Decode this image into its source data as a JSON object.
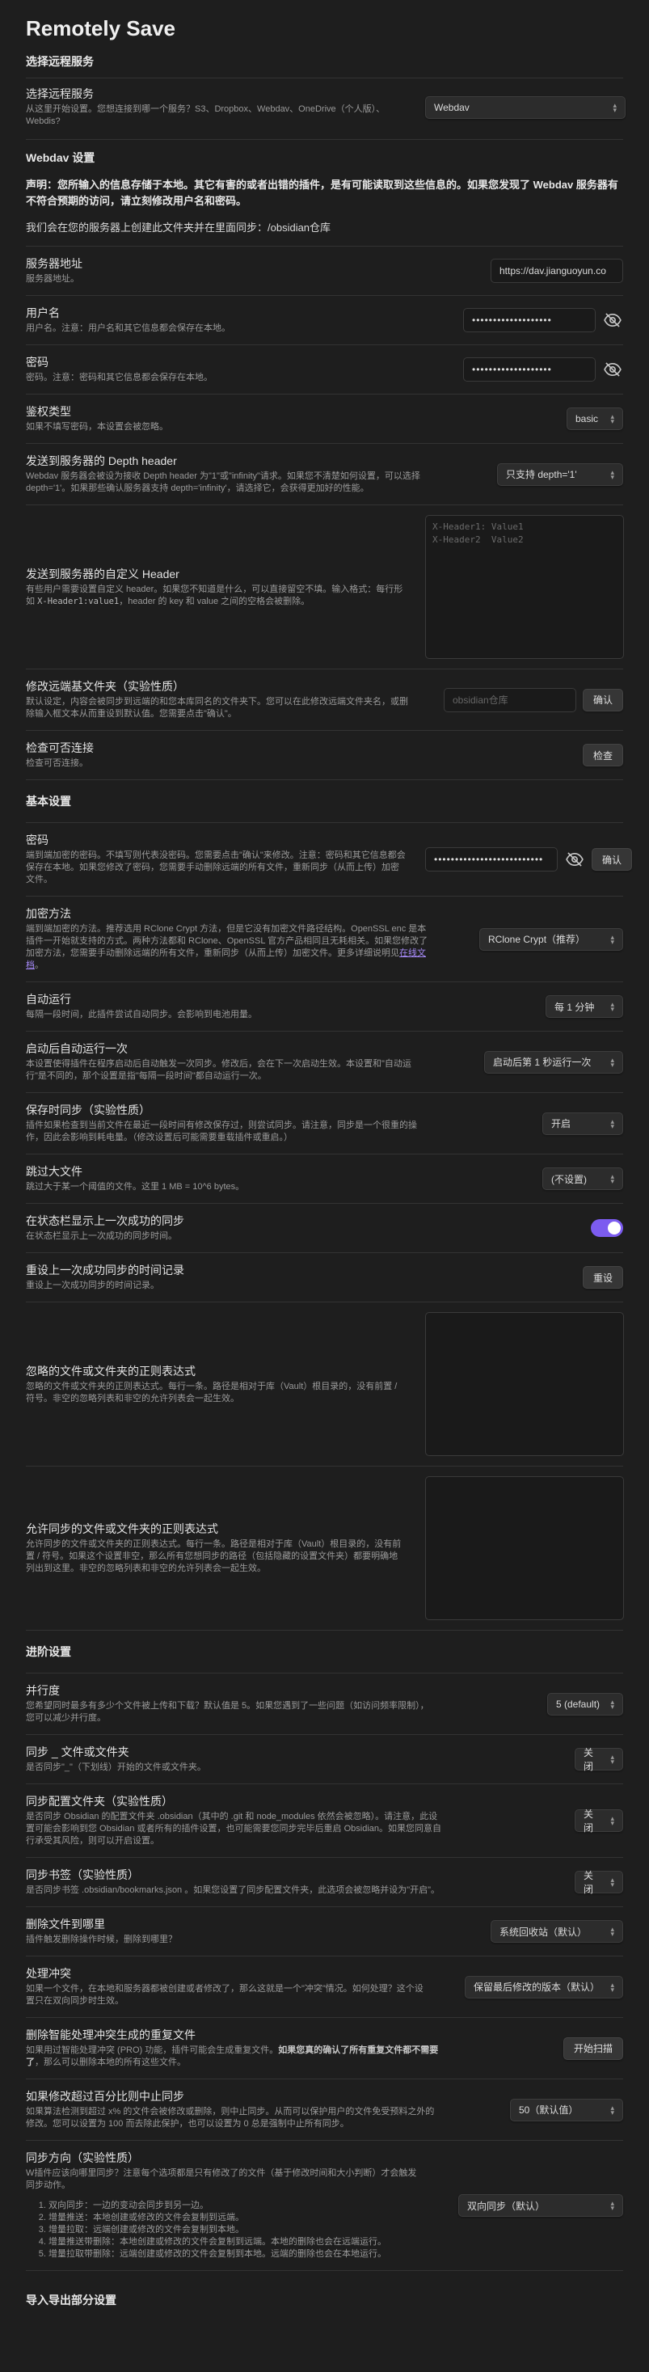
{
  "title": "Remotely Save",
  "choose_service": {
    "heading": "选择远程服务",
    "name": "选择远程服务",
    "desc": "从这里开始设置。您想连接到哪一个服务？S3、Dropbox、Webdav、OneDrive（个人版）、Webdis?",
    "value": "Webdav"
  },
  "webdav": {
    "heading": "Webdav 设置",
    "warning": "声明：您所输入的信息存储于本地。其它有害的或者出错的插件，是有可能读取到这些信息的。如果您发现了 Webdav 服务器有不符合预期的访问，请立刻修改用户名和密码。",
    "folder_note": "我们会在您的服务器上创建此文件夹并在里面同步：/obsidian仓库",
    "server": {
      "name": "服务器地址",
      "desc": "服务器地址。",
      "value": "https://dav.jianguoyun.co"
    },
    "username": {
      "name": "用户名",
      "desc": "用户名。注意：用户名和其它信息都会保存在本地。",
      "value": "•••••••••••••••••••"
    },
    "password": {
      "name": "密码",
      "desc": "密码。注意：密码和其它信息都会保存在本地。",
      "value": "•••••••••••••••••••"
    },
    "auth": {
      "name": "鉴权类型",
      "desc": "如果不填写密码，本设置会被忽略。",
      "value": "basic"
    },
    "depth": {
      "name": "发送到服务器的 Depth header",
      "desc": "Webdav 服务器会被设为接收 Depth header 为\"1\"或\"infinity\"请求。如果您不清楚如何设置，可以选择 depth='1'。如果那些确认服务器支持 depth='infinity'，请选择它，会获得更加好的性能。",
      "value": "只支持 depth='1'"
    },
    "custom_header": {
      "name": "发送到服务器的自定义 Header",
      "desc_prefix": "有些用户需要设置自定义 header。如果您不知道是什么，可以直接留空不填。输入格式：每行形如 ",
      "desc_code": "X-Header1:value1",
      "desc_suffix": "，header 的 key 和 value 之间的空格会被删除。",
      "placeholder": "X-Header1: Value1\nX-Header2  Value2"
    },
    "remote_folder": {
      "name": "修改远端基文件夹（实验性质）",
      "desc": "默认设定，内容会被同步到远端的和您本库同名的文件夹下。您可以在此修改远端文件夹名，或删除输入框文本从而重设到默认值。您需要点击\"确认\"。",
      "placeholder": "obsidian仓库",
      "button": "确认"
    },
    "check": {
      "name": "检查可否连接",
      "desc": "检查可否连接。",
      "button": "检查"
    }
  },
  "basic": {
    "heading": "基本设置",
    "password": {
      "name": "密码",
      "desc": "端到端加密的密码。不填写则代表没密码。您需要点击\"确认\"来修改。注意：密码和其它信息都会保存在本地。如果您修改了密码，您需要手动删除远端的所有文件，重新同步（从而上传）加密文件。",
      "value": "••••••••••••••••••••••••••",
      "button": "确认"
    },
    "encryption": {
      "name": "加密方法",
      "desc_prefix": "端到端加密的方法。推荐选用 RClone Crypt 方法，但是它没有加密文件路径结构。OpenSSL enc 是本插件一开始就支持的方式。两种方法都和 RClone、OpenSSL 官方产品相同且无耗相关。如果您修改了加密方法，您需要手动删除远端的所有文件，重新同步（从而上传）加密文件。更多详细说明见",
      "desc_link": "在线文档",
      "desc_suffix": "。",
      "value": "RClone Crypt（推荐）"
    },
    "auto_run": {
      "name": "自动运行",
      "desc": "每隔一段时间，此插件尝试自动同步。会影响到电池用量。",
      "value": "每 1 分钟"
    },
    "init_run": {
      "name": "启动后自动运行一次",
      "desc": "本设置使得插件在程序启动后自动触发一次同步。修改后，会在下一次启动生效。本设置和\"自动运行\"是不同的，那个设置是指\"每隔一段时间\"都自动运行一次。",
      "value": "启动后第 1 秒运行一次"
    },
    "save_sync": {
      "name": "保存时同步（实验性质）",
      "desc": "插件如果检查到当前文件在最近一段时间有修改保存过，则尝试同步。请注意，同步是一个很重的操作，因此会影响到耗电量。（修改设置后可能需要重载插件或重启。）",
      "value": "开启"
    },
    "skip_large": {
      "name": "跳过大文件",
      "desc": "跳过大于某一个阈值的文件。这里 1 MB = 10^6 bytes。",
      "value": "(不设置)"
    },
    "status_bar": {
      "name": "在状态栏显示上一次成功的同步",
      "desc": "在状态栏显示上一次成功的同步时间。",
      "value": true
    },
    "reset_status": {
      "name": "重设上一次成功同步的时间记录",
      "desc": "重设上一次成功同步的时间记录。",
      "button": "重设"
    },
    "ignore_paths": {
      "name": "忽略的文件或文件夹的正则表达式",
      "desc": "忽略的文件或文件夹的正则表达式。每行一条。路径是相对于库（Vault）根目录的，没有前置 / 符号。非空的忽略列表和非空的允许列表会一起生效。"
    },
    "allow_paths": {
      "name": "允许同步的文件或文件夹的正则表达式",
      "desc": "允许同步的文件或文件夹的正则表达式。每行一条。路径是相对于库（Vault）根目录的，没有前置 / 符号。如果这个设置非空，那么所有您想同步的路径（包括隐藏的设置文件夹）都要明确地列出到这里。非空的忽略列表和非空的允许列表会一起生效。"
    }
  },
  "advanced": {
    "heading": "进阶设置",
    "concurrency": {
      "name": "并行度",
      "desc": "您希望同时最多有多少个文件被上传和下载？默认值是 5。如果您遇到了一些问题（如访问频率限制），您可以减少并行度。",
      "value": "5 (default)"
    },
    "underscore": {
      "name": "同步 _ 文件或文件夹",
      "desc": "是否同步\"_\"（下划线）开始的文件或文件夹。",
      "value": "关闭"
    },
    "config_dir": {
      "name": "同步配置文件夹（实验性质）",
      "desc": "是否同步 Obsidian 的配置文件夹 .obsidian（其中的 .git 和 node_modules 依然会被忽略）。请注意，此设置可能会影响到您 Obsidian 或者所有的插件设置，也可能需要您同步完毕后重启 Obsidian。如果您同意自行承受其风险，则可以开启设置。",
      "value": "关闭"
    },
    "bookmarks": {
      "name": "同步书签（实验性质）",
      "desc": "是否同步书签 .obsidian/bookmarks.json 。如果您设置了同步配置文件夹，此选项会被忽略并设为\"开启\"。",
      "value": "关闭"
    },
    "delete_to": {
      "name": "删除文件到哪里",
      "desc": "插件触发删除操作时候，删除到哪里？",
      "value": "系统回收站（默认）"
    },
    "conflict": {
      "name": "处理冲突",
      "desc": "如果一个文件，在本地和服务器都被创建或者修改了，那么这就是一个\"冲突\"情况。如何处理？这个设置只在双向同步时生效。",
      "value": "保留最后修改的版本（默认）"
    },
    "duplicate": {
      "name": "删除智能处理冲突生成的重复文件",
      "desc_prefix": "如果用过智能处理冲突 (PRO) 功能，插件可能会生成重复文件。",
      "desc_bold": "如果您真的确认了所有重复文件都不需要了",
      "desc_suffix": "，那么可以删除本地的所有这些文件。",
      "button": "开始扫描"
    },
    "abort_pct": {
      "name": "如果修改超过百分比则中止同步",
      "desc": "如果算法检测到超过 x% 的文件会被修改或删除，则中止同步。从而可以保护用户的文件免受预料之外的修改。您可以设置为 100 而去除此保护，也可以设置为 0 总是强制中止所有同步。",
      "value": "50（默认值）"
    },
    "direction": {
      "name": "同步方向（实验性质）",
      "desc": "W插件应该向哪里同步？注意每个选项都是只有修改了的文件（基于修改时间和大小判断）才会触发同步动作。",
      "items": [
        "双向同步：一边的变动会同步到另一边。",
        "增量推送：本地创建或修改的文件会复制到远端。",
        "增量拉取：远端创建或修改的文件会复制到本地。",
        "增量推送带删除：本地创建或修改的文件会复制到远端。本地的删除也会在远端运行。",
        "增量拉取带删除：远端创建或修改的文件会复制到本地。远端的删除也会在本地运行。"
      ],
      "value": "双向同步（默认）"
    }
  },
  "import_export": {
    "heading": "导入导出部分设置"
  }
}
